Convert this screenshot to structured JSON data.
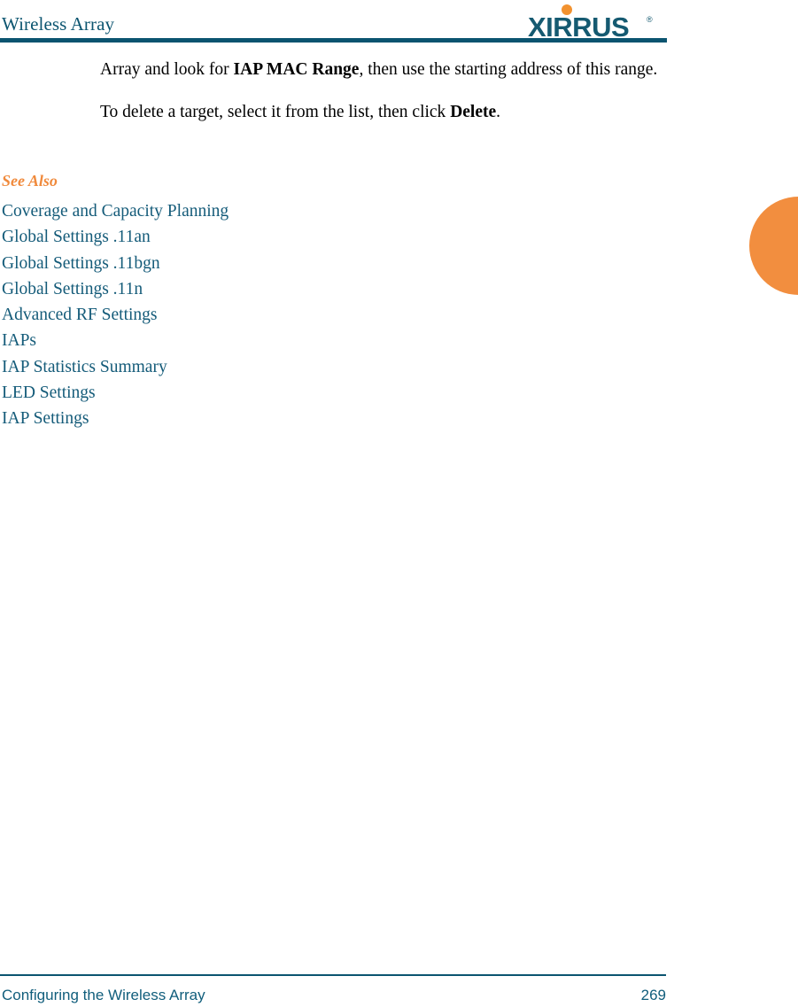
{
  "header": {
    "title": "Wireless Array",
    "logo_text": "XIRRUS",
    "logo_trademark": "®"
  },
  "body": {
    "paragraph_1_pre": "Array and look for ",
    "paragraph_1_bold": "IAP MAC Range",
    "paragraph_1_post": ", then use the starting address of this range.",
    "paragraph_2_pre": "To delete a target, select it from the list, then click ",
    "paragraph_2_bold": "Delete",
    "paragraph_2_post": "."
  },
  "see_also": {
    "heading": "See Also",
    "links": [
      {
        "label": "Coverage and Capacity Planning"
      },
      {
        "label": "Global Settings .11an"
      },
      {
        "label": "Global Settings .11bgn"
      },
      {
        "label": "Global Settings .11n"
      },
      {
        "label": "Advanced RF Settings"
      },
      {
        "label": "IAPs"
      },
      {
        "label": "IAP Statistics Summary"
      },
      {
        "label": "LED Settings"
      },
      {
        "label": "IAP Settings"
      }
    ]
  },
  "footer": {
    "section": "Configuring the Wireless Array",
    "page_number": "269"
  },
  "colors": {
    "teal": "#0b5470",
    "link_teal": "#145b79",
    "orange": "#f08a3c",
    "tab_orange": "#f28e3f",
    "logo_teal": "#155a71",
    "footer_teal": "#115e7c"
  }
}
